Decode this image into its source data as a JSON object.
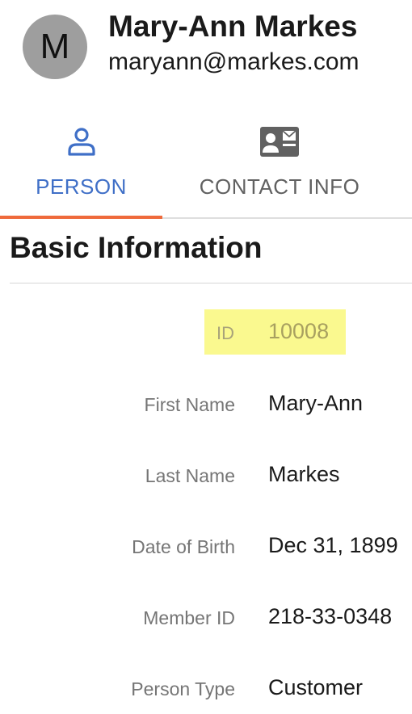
{
  "profile": {
    "avatar_initial": "M",
    "name": "Mary-Ann Markes",
    "email": "maryann@markes.com"
  },
  "tabs": [
    {
      "label": "PERSON",
      "icon": "person-icon",
      "active": true
    },
    {
      "label": "CONTACT INFO",
      "icon": "contact-card-icon",
      "active": false
    }
  ],
  "colors": {
    "accent": "#3f6fc7",
    "tab_indicator": "#ef6a3b",
    "highlight": "#faf98f",
    "avatar_bg": "#9e9e9e"
  },
  "section": {
    "title": "Basic Information"
  },
  "fields": {
    "id": {
      "label": "ID",
      "value": "10008"
    },
    "first_name": {
      "label": "First Name",
      "value": "Mary-Ann"
    },
    "last_name": {
      "label": "Last Name",
      "value": "Markes"
    },
    "dob": {
      "label": "Date of Birth",
      "value": "Dec 31, 1899"
    },
    "member_id": {
      "label": "Member ID",
      "value": "218-33-0348"
    },
    "person_type": {
      "label": "Person Type",
      "value": "Customer"
    }
  }
}
